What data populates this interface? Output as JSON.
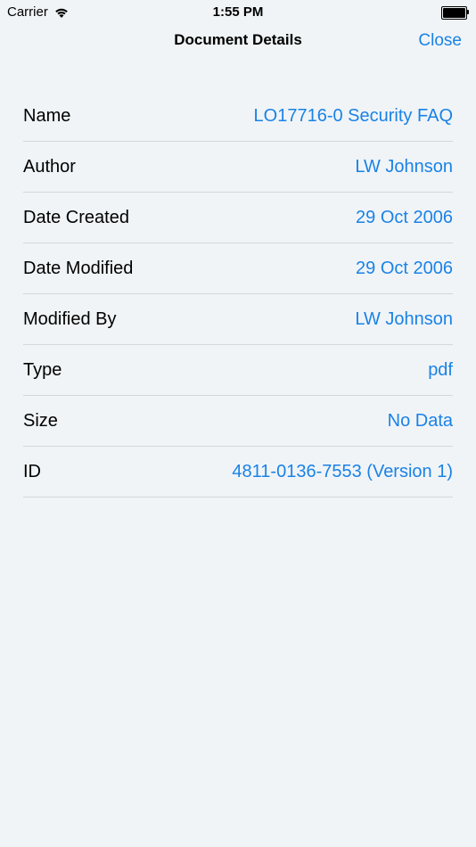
{
  "status_bar": {
    "carrier": "Carrier",
    "time": "1:55 PM"
  },
  "nav": {
    "title": "Document Details",
    "close_label": "Close"
  },
  "details": [
    {
      "label": "Name",
      "value": "LO17716-0 Security FAQ"
    },
    {
      "label": "Author",
      "value": "LW Johnson"
    },
    {
      "label": "Date Created",
      "value": "29 Oct 2006"
    },
    {
      "label": "Date Modified",
      "value": "29 Oct 2006"
    },
    {
      "label": "Modified By",
      "value": "LW Johnson"
    },
    {
      "label": "Type",
      "value": "pdf"
    },
    {
      "label": "Size",
      "value": "No Data"
    },
    {
      "label": "ID",
      "value": "4811-0136-7553 (Version 1)"
    }
  ],
  "colors": {
    "accent": "#1a82e6",
    "background": "#f0f4f7",
    "separator": "#d3d7da"
  }
}
